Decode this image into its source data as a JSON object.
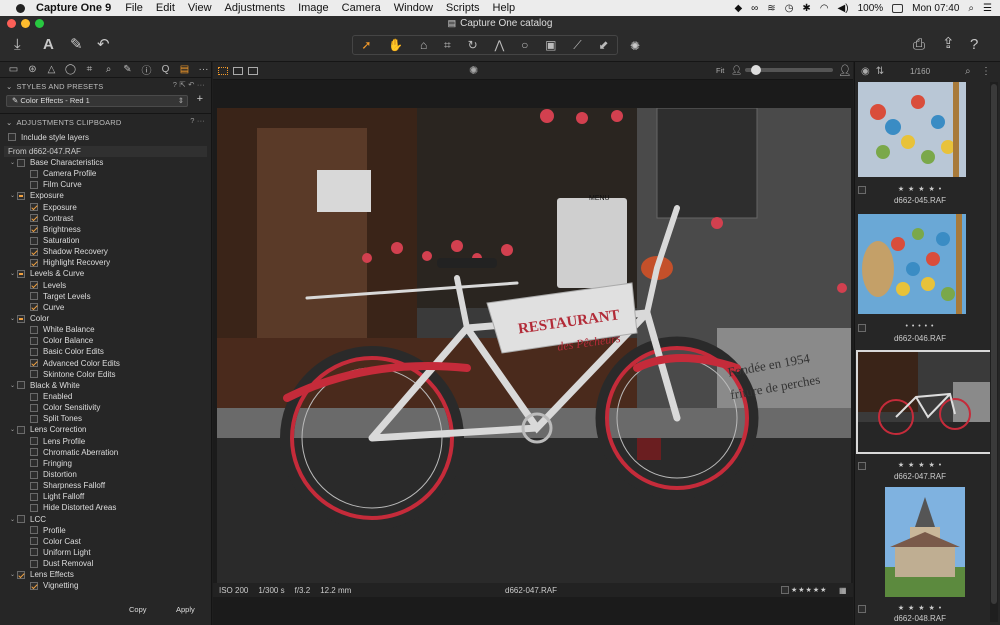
{
  "menubar": {
    "app": "Capture One 9",
    "items": [
      "File",
      "Edit",
      "View",
      "Adjustments",
      "Image",
      "Camera",
      "Window",
      "Scripts",
      "Help"
    ],
    "battery": "100%",
    "clock": "Mon 07:40"
  },
  "window": {
    "title": "Capture One catalog"
  },
  "left": {
    "styles_header": "STYLES AND PRESETS",
    "preset_value": "Color Effects - Red 1",
    "clipboard_header": "ADJUSTMENTS CLIPBOARD",
    "include_label": "Include style layers",
    "from_label": "From d662-047.RAF",
    "rows": [
      {
        "label": "Base Characteristics",
        "level": 0,
        "state": "none"
      },
      {
        "label": "Camera Profile",
        "level": 1,
        "state": "none"
      },
      {
        "label": "Film Curve",
        "level": 1,
        "state": "none"
      },
      {
        "label": "Exposure",
        "level": 0,
        "state": "partial"
      },
      {
        "label": "Exposure",
        "level": 1,
        "state": "checked"
      },
      {
        "label": "Contrast",
        "level": 1,
        "state": "checked"
      },
      {
        "label": "Brightness",
        "level": 1,
        "state": "checked"
      },
      {
        "label": "Saturation",
        "level": 1,
        "state": "none"
      },
      {
        "label": "Shadow Recovery",
        "level": 1,
        "state": "checked"
      },
      {
        "label": "Highlight Recovery",
        "level": 1,
        "state": "checked"
      },
      {
        "label": "Levels & Curve",
        "level": 0,
        "state": "partial"
      },
      {
        "label": "Levels",
        "level": 1,
        "state": "checked"
      },
      {
        "label": "Target Levels",
        "level": 1,
        "state": "none"
      },
      {
        "label": "Curve",
        "level": 1,
        "state": "checked"
      },
      {
        "label": "Color",
        "level": 0,
        "state": "partial"
      },
      {
        "label": "White Balance",
        "level": 1,
        "state": "none"
      },
      {
        "label": "Color Balance",
        "level": 1,
        "state": "none"
      },
      {
        "label": "Basic Color Edits",
        "level": 1,
        "state": "none"
      },
      {
        "label": "Advanced Color Edits",
        "level": 1,
        "state": "checked"
      },
      {
        "label": "Skintone Color Edits",
        "level": 1,
        "state": "none"
      },
      {
        "label": "Black & White",
        "level": 0,
        "state": "none"
      },
      {
        "label": "Enabled",
        "level": 1,
        "state": "none"
      },
      {
        "label": "Color Sensitivity",
        "level": 1,
        "state": "none"
      },
      {
        "label": "Split Tones",
        "level": 1,
        "state": "none"
      },
      {
        "label": "Lens Correction",
        "level": 0,
        "state": "none"
      },
      {
        "label": "Lens Profile",
        "level": 1,
        "state": "none"
      },
      {
        "label": "Chromatic Aberration",
        "level": 1,
        "state": "none"
      },
      {
        "label": "Fringing",
        "level": 1,
        "state": "none"
      },
      {
        "label": "Distortion",
        "level": 1,
        "state": "none"
      },
      {
        "label": "Sharpness Falloff",
        "level": 1,
        "state": "none"
      },
      {
        "label": "Light Falloff",
        "level": 1,
        "state": "none"
      },
      {
        "label": "Hide Distorted Areas",
        "level": 1,
        "state": "none"
      },
      {
        "label": "LCC",
        "level": 0,
        "state": "none"
      },
      {
        "label": "Profile",
        "level": 1,
        "state": "none"
      },
      {
        "label": "Color Cast",
        "level": 1,
        "state": "none"
      },
      {
        "label": "Uniform Light",
        "level": 1,
        "state": "none"
      },
      {
        "label": "Dust Removal",
        "level": 1,
        "state": "none"
      },
      {
        "label": "Lens Effects",
        "level": 0,
        "state": "checked"
      },
      {
        "label": "Vignetting",
        "level": 1,
        "state": "checked"
      }
    ],
    "copy_label": "Copy",
    "apply_label": "Apply"
  },
  "viewer": {
    "fit_label": "Fit",
    "counter": "1/160",
    "filename": "d662-047.RAF",
    "iso": "ISO 200",
    "shutter": "1/300 s",
    "aperture": "f/3.2",
    "focal": "12.2 mm",
    "sign_text": "RESTAURANT",
    "sign_script": "des Pêcheurs",
    "wall_text1": "Fondée en 1954",
    "wall_text2": "friture de perches",
    "menu_text": "MENU",
    "stars": "★★★★★"
  },
  "filmstrip": [
    {
      "name": "d662-045.RAF",
      "stars": "★ ★ ★ ★ •"
    },
    {
      "name": "d662-046.RAF",
      "stars": "• • • • •"
    },
    {
      "name": "d662-047.RAF",
      "stars": "★ ★ ★ ★ •"
    },
    {
      "name": "d662-048.RAF",
      "stars": "★ ★ ★ ★ •"
    }
  ],
  "colors": {
    "accent": "#f39a2a",
    "bike_red": "#c52b3a"
  }
}
